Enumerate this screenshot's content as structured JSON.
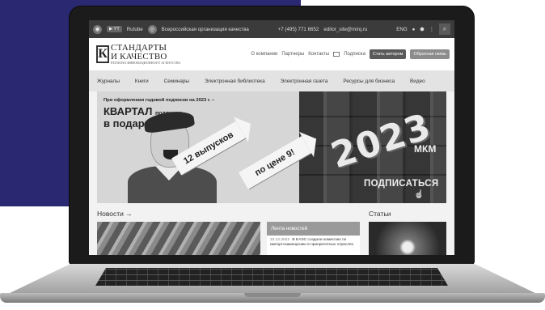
{
  "topbar": {
    "items": [
      "Rutube",
      "Всероссийская организация качества"
    ],
    "phone": "+7 (495) 771 6652",
    "email": "editor_site@mirq.ru",
    "lang": "ENG"
  },
  "header": {
    "logo_line1": "СТАНДАРТЫ",
    "logo_line2": "И КАЧЕСТВО",
    "logo_tagline": "РЕГИОНА ИННОВАЦИОННОГО АГЕНТСТВА",
    "links": [
      "О компании",
      "Партнеры",
      "Контакты",
      "Подписка"
    ],
    "btn_author": "Стать автором",
    "btn_feedback": "Обратная связь"
  },
  "nav": {
    "items": [
      "Журналы",
      "Книги",
      "Семинары",
      "Электронная библиотека",
      "Электронная газета",
      "Ресурсы для бизнеса",
      "Видео"
    ]
  },
  "banner": {
    "offer": "При оформлении годовой подписки на 2023 г. –",
    "kvartal": "КВАРТАЛ",
    "podpiski": "подписки",
    "gift": "в подарок!",
    "arrow1": "12 выпусков",
    "arrow2": "по цене 9!",
    "year": "2023",
    "mkm": "МКМ",
    "subscribe": "ПОДПИСАТЬСЯ"
  },
  "news": {
    "title": "Новости →",
    "feed_title": "Лента новостей",
    "feed_item_date": "23.12.2022",
    "feed_item_text": "В ЕАЭС создали комиссию по импортозамещению в приоритетных отраслях"
  },
  "articles": {
    "title": "Статьи"
  }
}
